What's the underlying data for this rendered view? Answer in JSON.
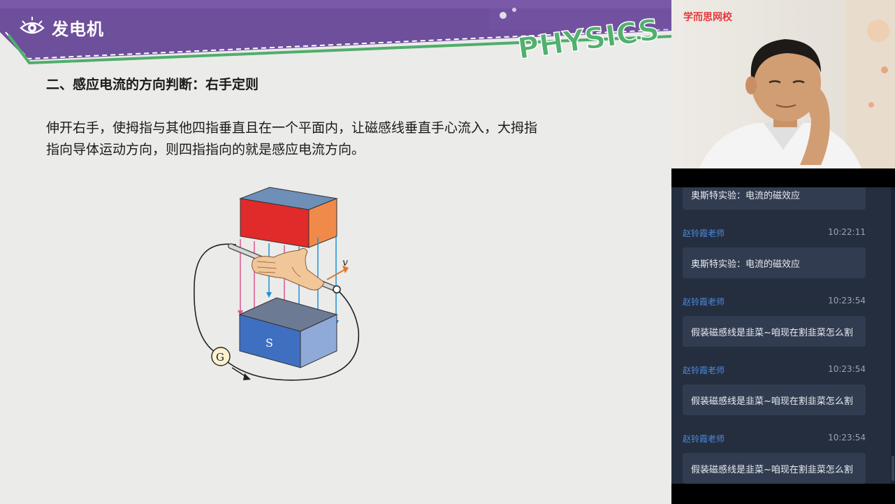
{
  "slide": {
    "banner_title": "发电机",
    "banner_watermark": "PHYSICS",
    "heading": "二、感应电流的方向判断：右手定则",
    "body_line_1": "伸开右手，使拇指与其他四指垂直且在一个平面内，让磁感线垂直手心流入，大拇指",
    "body_line_2": "指向导体运动方向，则四指指向的就是感应电流方向。",
    "diagram": {
      "pole_label": "S",
      "meter_label": "G",
      "velocity_label": "v"
    }
  },
  "video": {
    "logo_text": "学而思网校"
  },
  "chat": {
    "messages": [
      {
        "sender": "",
        "time": "",
        "text": "奥斯特实验：电流的磁效应"
      },
      {
        "sender": "赵铃霞老师",
        "time": "10:22:11",
        "text": "奥斯特实验：电流的磁效应"
      },
      {
        "sender": "赵铃霞老师",
        "time": "10:23:54",
        "text": "假装磁感线是韭菜~咱现在割韭菜怎么割"
      },
      {
        "sender": "赵铃霞老师",
        "time": "10:23:54",
        "text": "假装磁感线是韭菜~咱现在割韭菜怎么割"
      },
      {
        "sender": "赵铃霞老师",
        "time": "10:23:54",
        "text": "假装磁感线是韭菜~咱现在割韭菜怎么割"
      }
    ]
  },
  "colors": {
    "banner_purple": "#6e4f9b",
    "banner_green": "#4fae6a",
    "slide_bg": "#ebebea",
    "chat_bg": "#252e3f",
    "bubble_bg": "#323c50",
    "sender_blue": "#4a8be0",
    "magnet_north": "#e12a2a",
    "magnet_south": "#4a78c0",
    "field_pink": "#d8588f",
    "field_blue": "#1f8fd8"
  }
}
